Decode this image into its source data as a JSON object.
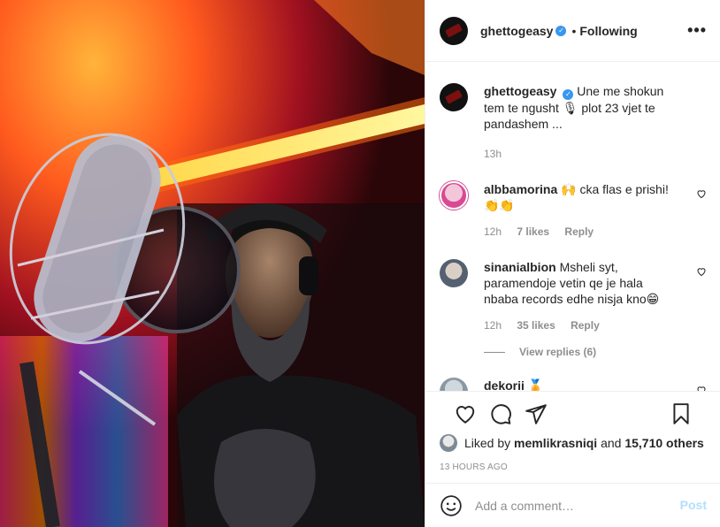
{
  "post": {
    "username": "ghettogeasy",
    "follow_status": "Following",
    "more_icon": "more-horizontal-icon",
    "caption": "Une me shokun tem te ngusht 🎙 plot 23 vjet te pandashem ...",
    "caption_time": "13h"
  },
  "comments": [
    {
      "username": "albbamorina",
      "text": "🙌 cka flas e prishi! 👏👏",
      "time": "12h",
      "likes": "7 likes",
      "reply": "Reply"
    },
    {
      "username": "sinanialbion",
      "text": "Msheli syt, paramendoje vetin qe je hala nbaba records edhe nisja kno😁",
      "time": "12h",
      "likes": "35 likes",
      "reply": "Reply",
      "view_replies": "View replies (6)"
    },
    {
      "username": "dekorii",
      "text": "🏅"
    }
  ],
  "actions": {
    "liked_by_prefix": "Liked by",
    "liked_by_user": "memlikrasniqi",
    "liked_by_and": "and",
    "liked_by_others": "15,710 others",
    "timestamp": "13 HOURS AGO"
  },
  "add_comment": {
    "placeholder": "Add a comment…",
    "post_label": "Post"
  },
  "colors": {
    "verified": "#3897f0",
    "post_disabled": "#b2dffc",
    "secondary_text": "#8e8e8e"
  }
}
